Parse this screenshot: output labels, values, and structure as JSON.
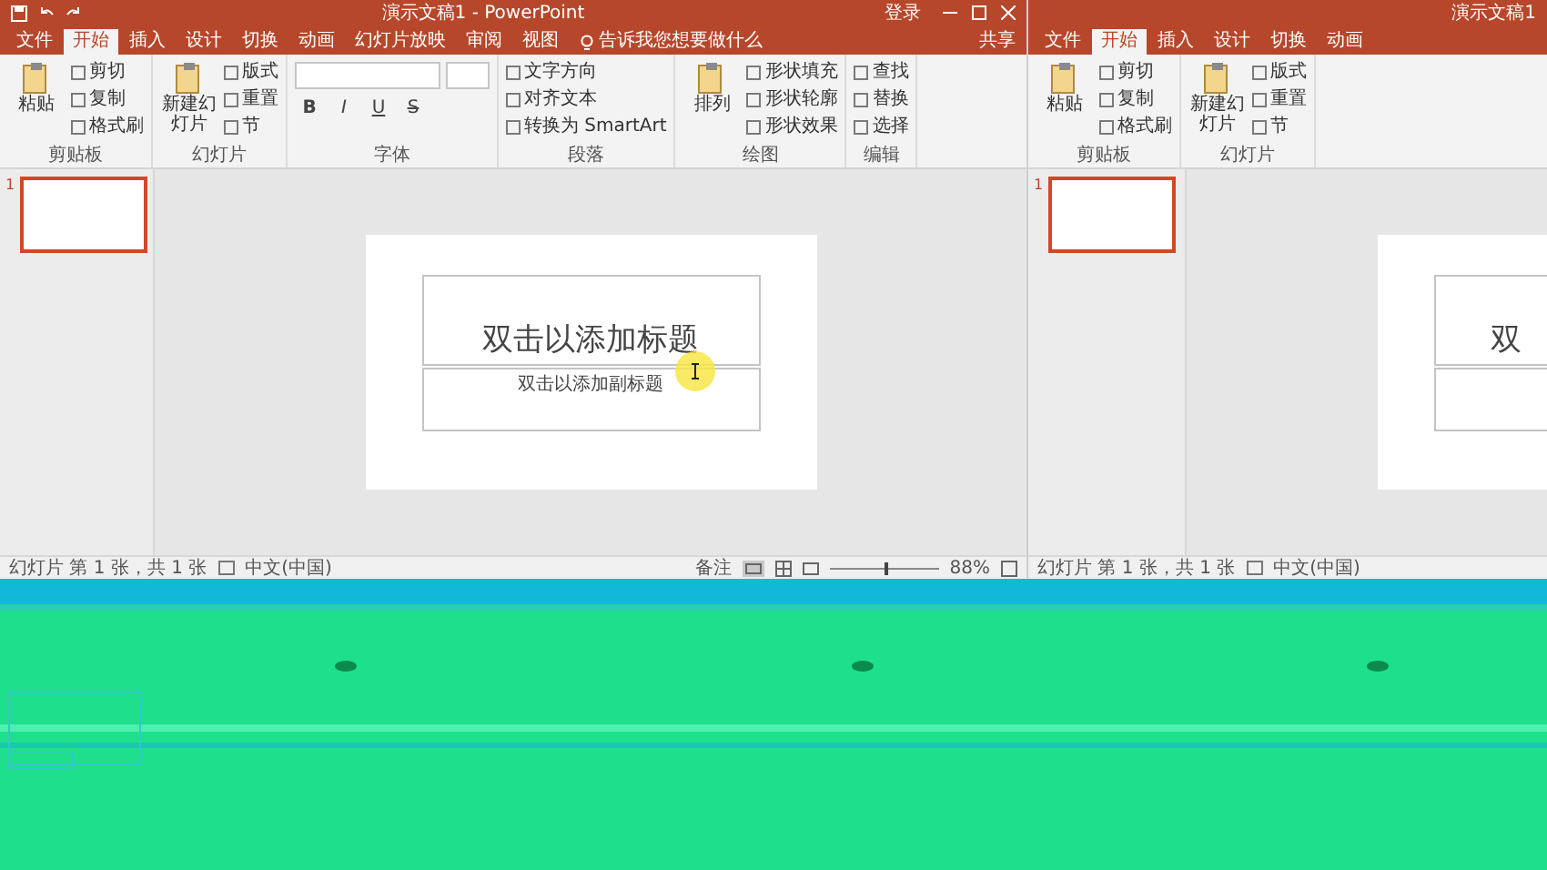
{
  "windows": [
    {
      "title": "演示文稿1 - PowerPoint",
      "account": "登录",
      "tabs": [
        {
          "label": "文件",
          "selected": false
        },
        {
          "label": "开始",
          "selected": true
        },
        {
          "label": "插入",
          "selected": false
        },
        {
          "label": "设计",
          "selected": false
        },
        {
          "label": "切换",
          "selected": false
        },
        {
          "label": "动画",
          "selected": false
        },
        {
          "label": "幻灯片放映",
          "selected": false
        },
        {
          "label": "审阅",
          "selected": false
        },
        {
          "label": "视图",
          "selected": false
        }
      ],
      "tell_me": "告诉我您想要做什么",
      "share": "共享",
      "ribbon": [
        {
          "kind": "buttons",
          "label": "剪贴板",
          "large": "粘贴",
          "small": [
            "剪切",
            "复制",
            "格式刷"
          ]
        },
        {
          "kind": "buttons",
          "label": "幻灯片",
          "large": "新建幻灯片",
          "small": [
            "版式",
            "重置",
            "节"
          ]
        },
        {
          "kind": "font",
          "label": "字体",
          "format": [
            "B",
            "I",
            "U",
            "S"
          ]
        },
        {
          "kind": "buttons",
          "label": "段落",
          "small": [
            "文字方向",
            "对齐文本",
            "转换为 SmartArt"
          ]
        },
        {
          "kind": "buttons",
          "label": "绘图",
          "large": "排列",
          "small": [
            "形状填充",
            "形状轮廓",
            "形状效果"
          ]
        },
        {
          "kind": "buttons",
          "label": "编辑",
          "small": [
            "查找",
            "替换",
            "选择"
          ]
        }
      ],
      "thumbnails": [
        {
          "number": "1",
          "selected": true
        }
      ],
      "slide": {
        "title": "双击以添加标题",
        "subtitle": "双击以添加副标题"
      },
      "status": {
        "slide_info": "幻灯片 第 1 张，共 1 张",
        "language": "中文(中国)",
        "notes": "备注",
        "zoom_slider": {
          "level": 0.5
        },
        "zoom": "88%"
      }
    },
    {
      "title": "演示文稿1",
      "tabs": [
        {
          "label": "文件",
          "selected": false
        },
        {
          "label": "开始",
          "selected": true
        },
        {
          "label": "插入",
          "selected": false
        },
        {
          "label": "设计",
          "selected": false
        },
        {
          "label": "切换",
          "selected": false
        },
        {
          "label": "动画",
          "selected": false
        }
      ],
      "ribbon": [
        {
          "kind": "buttons",
          "label": "剪贴板",
          "large": "粘贴",
          "small": [
            "剪切",
            "复制",
            "格式刷"
          ]
        },
        {
          "kind": "buttons",
          "label": "幻灯片",
          "large": "新建幻灯片",
          "small": [
            "版式",
            "重置",
            "节"
          ]
        }
      ],
      "thumbnails": [
        {
          "number": "1",
          "selected": true
        }
      ],
      "slide": {
        "title": "双"
      },
      "status": {
        "slide_info": "幻灯片 第 1 张，共 1 张",
        "language": "中文(中国)"
      }
    }
  ]
}
